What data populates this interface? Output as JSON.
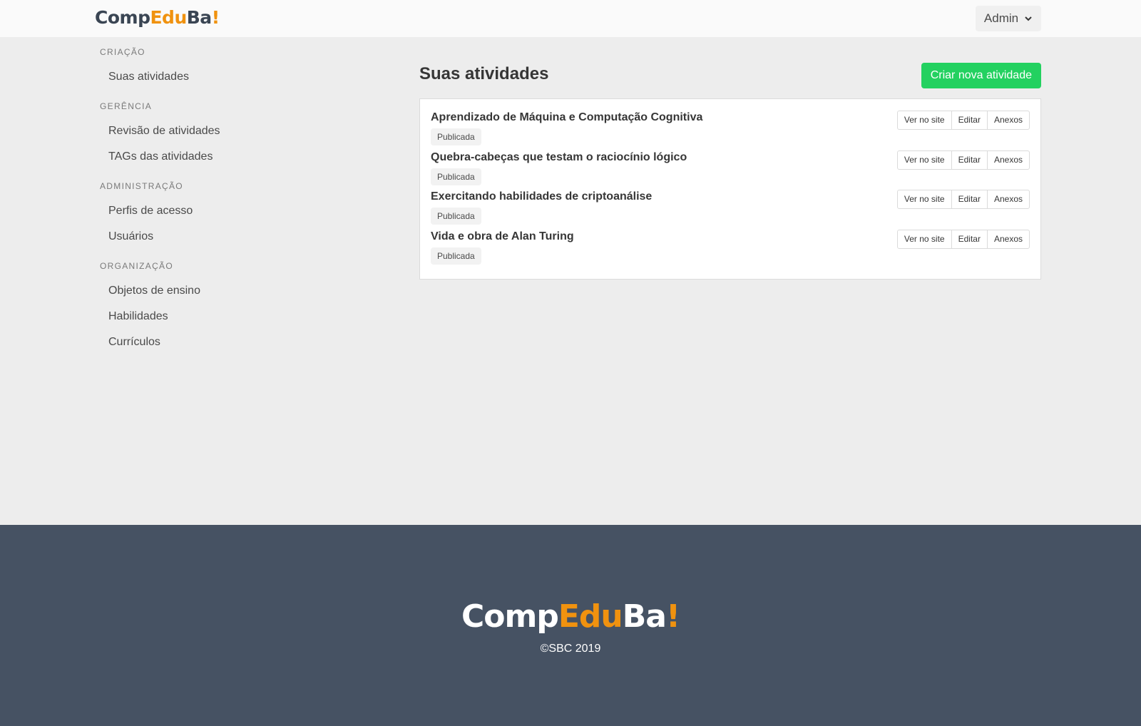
{
  "header": {
    "logo": {
      "part1": "Comp",
      "part2": "Edu",
      "part3": "Ba",
      "part4": "!"
    },
    "user_menu": {
      "label": "Admin",
      "icon": "chevron-down-icon"
    }
  },
  "sidebar": {
    "sections": [
      {
        "label": "CRIAÇÃO",
        "items": [
          {
            "label": "Suas atividades"
          }
        ]
      },
      {
        "label": "GERÊNCIA",
        "items": [
          {
            "label": "Revisão de atividades"
          },
          {
            "label": "TAGs das atividades"
          }
        ]
      },
      {
        "label": "ADMINISTRAÇÃO",
        "items": [
          {
            "label": "Perfis de acesso"
          },
          {
            "label": "Usuários"
          }
        ]
      },
      {
        "label": "ORGANIZAÇÃO",
        "items": [
          {
            "label": "Objetos de ensino"
          },
          {
            "label": "Habilidades"
          },
          {
            "label": "Currículos"
          }
        ]
      }
    ]
  },
  "main": {
    "title": "Suas atividades",
    "create_button": "Criar nova atividade",
    "activities": [
      {
        "title": "Aprendizado de Máquina e Computação Cognitiva",
        "status": "Publicada"
      },
      {
        "title": "Quebra-cabeças que testam o raciocínio lógico",
        "status": "Publicada"
      },
      {
        "title": "Exercitando habilidades de criptoanálise",
        "status": "Publicada"
      },
      {
        "title": "Vida e obra de Alan Turing",
        "status": "Publicada"
      }
    ],
    "actions": {
      "view": "Ver no site",
      "edit": "Editar",
      "attachments": "Anexos"
    }
  },
  "footer": {
    "logo": {
      "part1": "Comp",
      "part2": "Edu",
      "part3": "Ba",
      "part4": "!"
    },
    "copyright": "©SBC 2019"
  },
  "colors": {
    "brand_dark": "#3a4553",
    "brand_orange": "#f0920f",
    "success": "#23d160",
    "footer_bg": "#465263",
    "page_bg": "#ededed"
  }
}
